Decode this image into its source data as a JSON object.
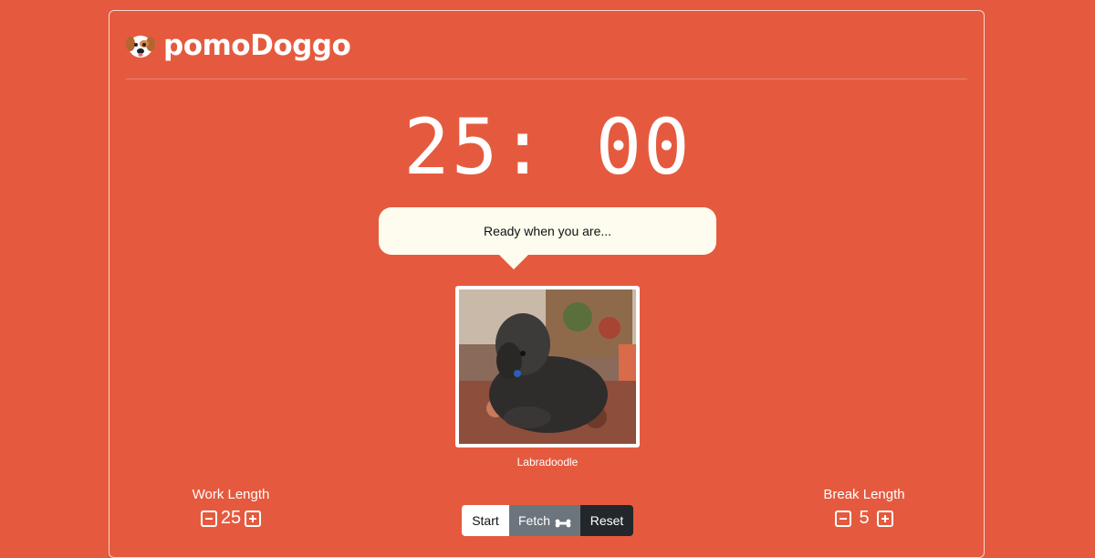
{
  "app": {
    "title": "pomoDoggo",
    "logo_icon": "dog-face-icon"
  },
  "timer": {
    "display": "25: 00"
  },
  "message": {
    "text": "Ready when you are..."
  },
  "dog": {
    "breed": "Labradoodle"
  },
  "work": {
    "label": "Work Length",
    "value": "25"
  },
  "break": {
    "label": "Break Length",
    "value": "5"
  },
  "controls": {
    "start": "Start",
    "fetch": "Fetch",
    "fetch_icon": "bone-icon",
    "reset": "Reset"
  },
  "colors": {
    "background": "#e55a3e",
    "bubble": "#fdfcee",
    "fetch": "#6c757d",
    "reset": "#23272b"
  }
}
